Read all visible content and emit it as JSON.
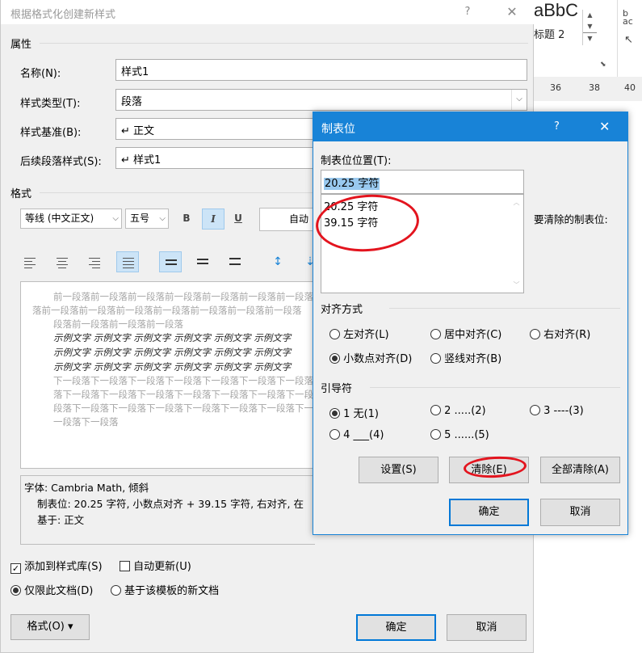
{
  "main_dialog": {
    "title": "根据格式化创建新样式",
    "help": "?",
    "close": "✕",
    "properties_heading": "属性",
    "name_label": "名称(N):",
    "name_value": "样式1",
    "type_label": "样式类型(T):",
    "type_value": "段落",
    "base_label": "样式基准(B):",
    "base_value": "↵ 正文",
    "next_label": "后续段落样式(S):",
    "next_value": "↵ 样式1",
    "format_heading": "格式",
    "font_value": "等线 (中文正文)",
    "size_value": "五号",
    "bold": "B",
    "italic": "I",
    "underline": "U",
    "color_value": "自动",
    "preview": {
      "prev_lines": [
        "前一段落前一段落前一段落前一段落前一段落前一段落前一段落",
        "落前一段落前一段落前一段落前一段落前一段落前一段落前一段落",
        "段落前一段落前一段落前一段落"
      ],
      "sample_lines": [
        "示例文字 示例文字 示例文字 示例文字 示例文字 示例文字",
        "示例文字 示例文字 示例文字 示例文字 示例文字 示例文字",
        "示例文字 示例文字 示例文字 示例文字 示例文字 示例文字"
      ],
      "next_lines": [
        "下一段落下一段落下一段落下一段落下一段落下一段落下一段落",
        "落下一段落下一段落下一段落下一段落下一段落下一段落下一段",
        "段落下一段落下一段落下一段落下一段落下一段落下一段落下一段落",
        "一段落下一段落"
      ]
    },
    "description": {
      "line1": "字体: Cambria Math, 倾斜",
      "line2": "制表位:  20.25 字符, 小数点对齐 +   39.15 字符, 右对齐, 在",
      "line3": "基于: 正文"
    },
    "add_to_gallery": "添加到样式库(S)",
    "auto_update": "自动更新(U)",
    "this_doc_only": "仅限此文档(D)",
    "template_based": "基于该模板的新文档",
    "format_button": "格式(O) ▾",
    "ok": "确定",
    "cancel": "取消"
  },
  "ribbon": {
    "style_preview": "aBbC",
    "style_name": "标题 2",
    "ruler_marks": [
      "36",
      "38",
      "40"
    ]
  },
  "tabs_dialog": {
    "title": "制表位",
    "help": "?",
    "close": "✕",
    "position_label": "制表位位置(T):",
    "position_value": "20.25 字符",
    "positions": [
      "20.25 字符",
      "39.15 字符"
    ],
    "clear_label": "要清除的制表位:",
    "alignment_heading": "对齐方式",
    "align_left": "左对齐(L)",
    "align_center": "居中对齐(C)",
    "align_right": "右对齐(R)",
    "align_decimal": "小数点对齐(D)",
    "align_bar": "竖线对齐(B)",
    "leader_heading": "引导符",
    "leader_1": "1 无(1)",
    "leader_2": "2 .....(2)",
    "leader_3": "3 ----(3)",
    "leader_4": "4 ___(4)",
    "leader_5": "5 ......(5)",
    "set_button": "设置(S)",
    "clear_button": "清除(E)",
    "clear_all_button": "全部清除(A)",
    "ok": "确定",
    "cancel": "取消"
  },
  "colors": {
    "accent": "#1883d7",
    "annotation": "#e3141e"
  }
}
